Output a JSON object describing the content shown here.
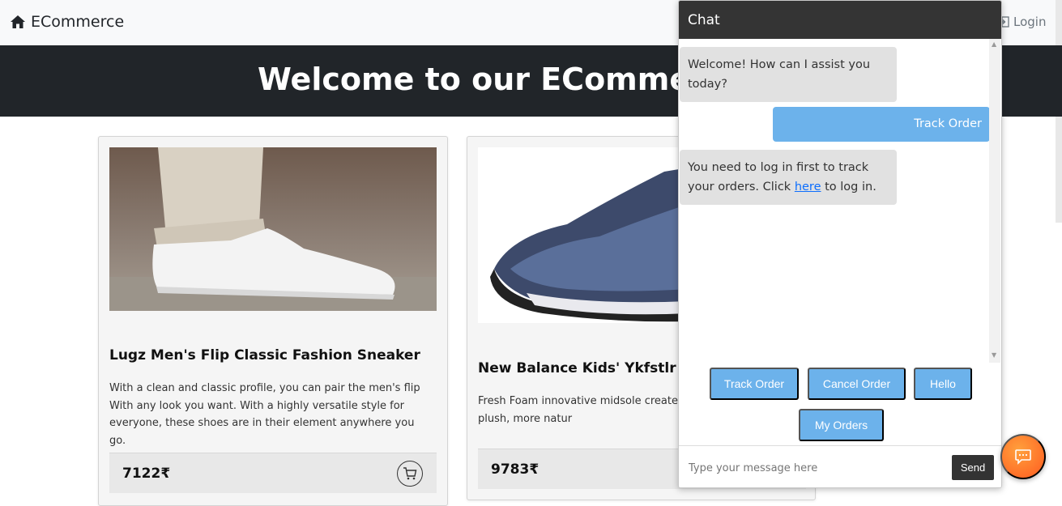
{
  "navbar": {
    "brand": "ECommerce",
    "brand_icon": "home-icon",
    "login_label": "Login",
    "login_icon": "login-icon"
  },
  "hero": {
    "title": "Welcome to our ECommerce"
  },
  "products": [
    {
      "title": "Lugz Men's Flip Classic Fashion Sneaker",
      "description": "With a clean and classic profile, you can pair the men's flip With any look you want. With a highly versatile style for everyone, these shoes are in their element anywhere you go.",
      "price": "7122₹",
      "cart_icon": "cart-icon"
    },
    {
      "title": "New Balance Kids' Ykfstlr",
      "description": "Fresh Foam innovative midsole created foam that provides a plush, more natur",
      "price": "9783₹"
    }
  ],
  "chat": {
    "title": "Chat",
    "messages": [
      {
        "from": "bot",
        "text": "Welcome! How can I assist you today?"
      },
      {
        "from": "user",
        "text": "Track Order"
      },
      {
        "from": "bot",
        "text_before": "You need to log in first to track your orders. Click ",
        "link_text": "here",
        "text_after": " to log in."
      }
    ],
    "quick_replies": [
      "Track Order",
      "Cancel Order",
      "Hello",
      "My Orders"
    ],
    "input_placeholder": "Type your message here",
    "send_label": "Send"
  },
  "fab": {
    "icon": "chat-bubble-icon"
  },
  "colors": {
    "navbar_bg": "#f8f9fa",
    "hero_bg": "#212529",
    "chat_header_bg": "#343434",
    "bot_bubble": "#e1e1e1",
    "user_bubble": "#6cb2eb",
    "quick_reply": "#6cb2eb",
    "send_button": "#333333",
    "fab_gradient_start": "#ffa13d",
    "fab_gradient_end": "#ff5a1f"
  }
}
